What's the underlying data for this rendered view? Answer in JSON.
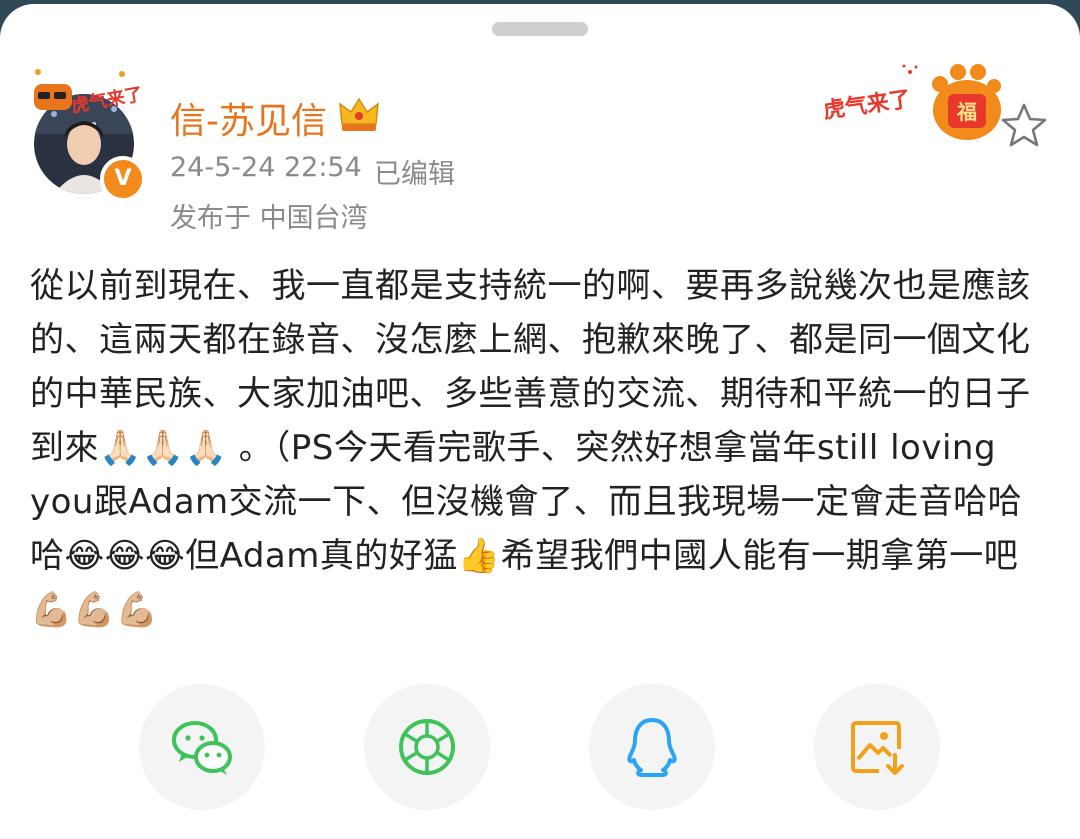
{
  "post": {
    "author": "信-苏见信",
    "timestamp": "24-5-24 22:54",
    "edited": "已编辑",
    "location": "发布于 中国台湾",
    "badge_text": "虎气来了",
    "badge_fu": "福",
    "avatar_frame_text": "虎气来了",
    "body": "從以前到現在、我一直都是支持統一的啊、要再多說幾次也是應該的、這兩天都在錄音、沒怎麼上網、抱歉來晚了、都是同一個文化的中華民族、大家加油吧、多些善意的交流、期待和平統一的日子到來🙏🏻🙏🏻🙏🏻 。（PS今天看完歌手、突然好想拿當年still loving you跟Adam交流一下、但沒機會了、而且我現場一定會走音哈哈哈😂😂😂但Adam真的好猛👍希望我們中國人能有一期拿第一吧💪🏼💪🏼💪🏼"
  },
  "share": {
    "buttons": [
      {
        "icon": "wechat-icon",
        "color": "#3fc25a"
      },
      {
        "icon": "moments-icon",
        "color": "#3fc25a"
      },
      {
        "icon": "qq-icon",
        "color": "#2aa4f4"
      },
      {
        "icon": "save-image-icon",
        "color": "#f2a019"
      }
    ]
  },
  "colors": {
    "accent": "#e8741c",
    "verified": "#f28a1c",
    "muted_text": "#8a8a8a",
    "badge_red": "#e8382c"
  }
}
